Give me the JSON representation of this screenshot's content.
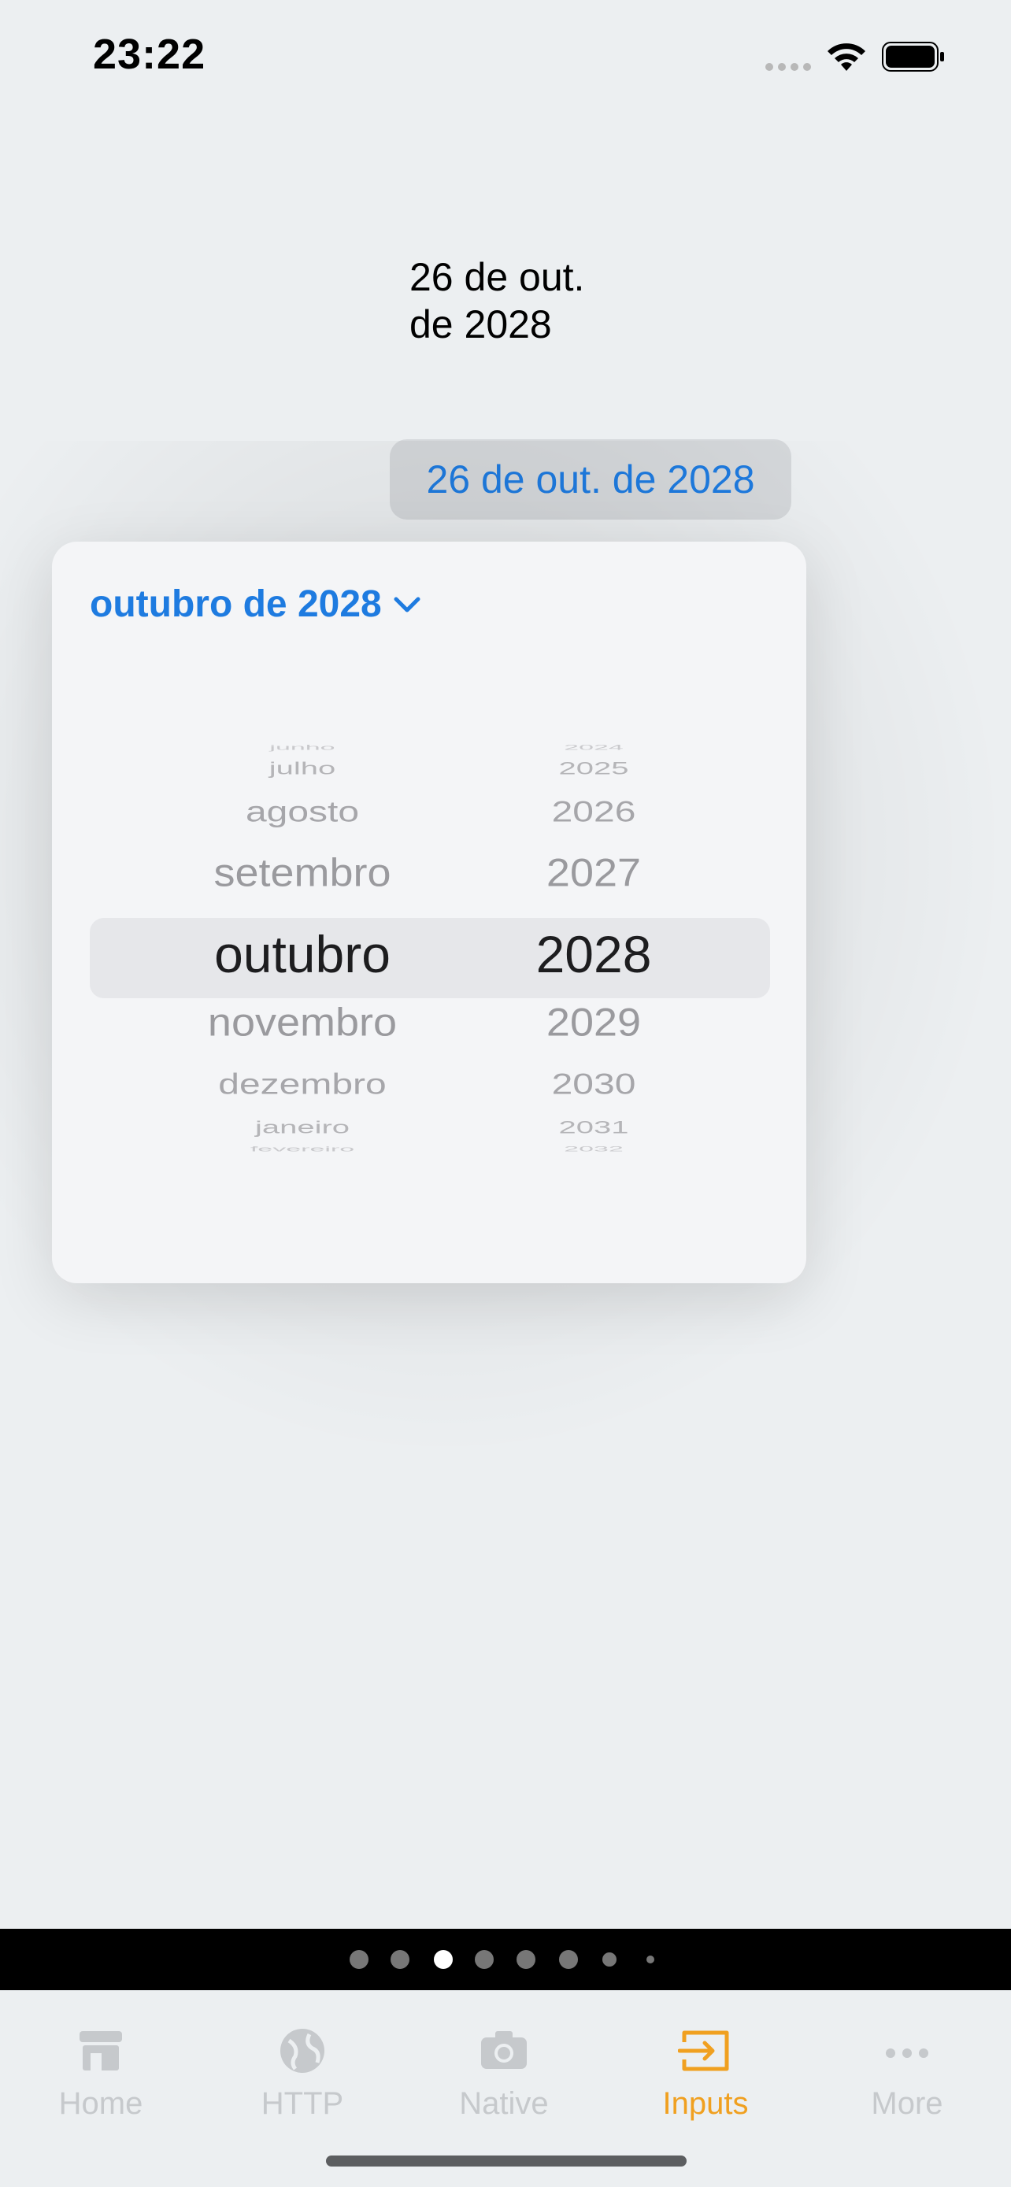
{
  "status_bar": {
    "time": "23:22"
  },
  "date_label": {
    "line1": "26 de out.",
    "line2": "de 2028"
  },
  "date_button": {
    "label": "26 de out. de 2028"
  },
  "picker": {
    "header": "outubro de 2028",
    "months": [
      "junho",
      "julho",
      "agosto",
      "setembro",
      "outubro",
      "novembro",
      "dezembro",
      "janeiro",
      "fevereiro"
    ],
    "years": [
      "2024",
      "2025",
      "2026",
      "2027",
      "2028",
      "2029",
      "2030",
      "2031",
      "2032"
    ],
    "selected_month": "outubro",
    "selected_year": "2028"
  },
  "page_indicator": {
    "count": 8,
    "active_index": 2
  },
  "tab_bar": {
    "tabs": [
      {
        "label": "Home",
        "icon": "storefront-icon"
      },
      {
        "label": "HTTP",
        "icon": "globe-icon"
      },
      {
        "label": "Native",
        "icon": "camera-icon"
      },
      {
        "label": "Inputs",
        "icon": "input-arrow-icon"
      },
      {
        "label": "More",
        "icon": "ellipsis-icon"
      }
    ],
    "active": "Inputs"
  },
  "colors": {
    "accent_blue": "#1e7be0",
    "active_tab": "#f0a020",
    "inactive_tab": "#c6c9cc"
  }
}
